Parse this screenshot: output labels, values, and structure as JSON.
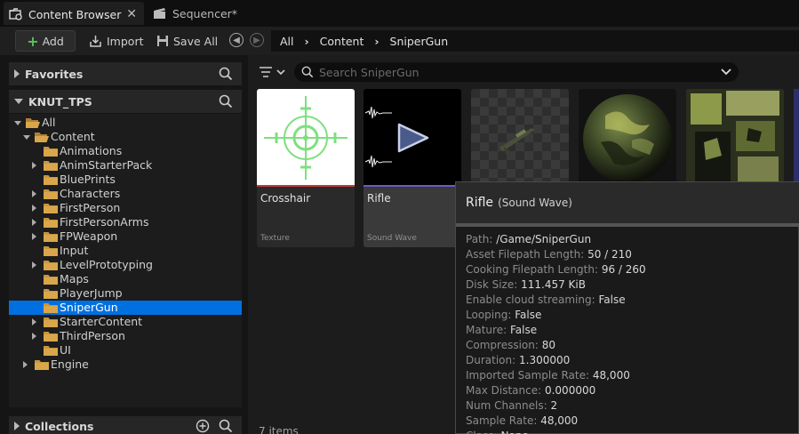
{
  "tabs": [
    {
      "label": "Content Browser",
      "active": true
    },
    {
      "label": "Sequencer*",
      "active": false
    }
  ],
  "toolbar": {
    "add": "Add",
    "import": "Import",
    "save_all": "Save All"
  },
  "breadcrumbs": [
    "All",
    "Content",
    "SniperGun"
  ],
  "favorites": {
    "label": "Favorites"
  },
  "project": {
    "label": "KNUT_TPS"
  },
  "tree": [
    {
      "label": "All",
      "depth": 0,
      "expanded": true,
      "has_children": true
    },
    {
      "label": "Content",
      "depth": 1,
      "expanded": true,
      "has_children": true
    },
    {
      "label": "Animations",
      "depth": 2,
      "has_children": false
    },
    {
      "label": "AnimStarterPack",
      "depth": 2,
      "has_children": true
    },
    {
      "label": "BluePrints",
      "depth": 2,
      "has_children": false
    },
    {
      "label": "Characters",
      "depth": 2,
      "has_children": true
    },
    {
      "label": "FirstPerson",
      "depth": 2,
      "has_children": true
    },
    {
      "label": "FirstPersonArms",
      "depth": 2,
      "has_children": true
    },
    {
      "label": "FPWeapon",
      "depth": 2,
      "has_children": true
    },
    {
      "label": "Input",
      "depth": 2,
      "has_children": false
    },
    {
      "label": "LevelPrototyping",
      "depth": 2,
      "has_children": true
    },
    {
      "label": "Maps",
      "depth": 2,
      "has_children": false
    },
    {
      "label": "PlayerJump",
      "depth": 2,
      "has_children": false
    },
    {
      "label": "SniperGun",
      "depth": 2,
      "has_children": false,
      "selected": true
    },
    {
      "label": "StarterContent",
      "depth": 2,
      "has_children": true
    },
    {
      "label": "ThirdPerson",
      "depth": 2,
      "has_children": true
    },
    {
      "label": "UI",
      "depth": 2,
      "has_children": false
    },
    {
      "label": "Engine",
      "depth": 1,
      "has_children": true
    }
  ],
  "collections": {
    "label": "Collections"
  },
  "search": {
    "placeholder": "Search SniperGun"
  },
  "assets": [
    {
      "name": "Crosshair",
      "type": "Texture",
      "color": "#c23b3b"
    },
    {
      "name": "Rifle",
      "type": "Sound Wave",
      "color": "#6a5acd"
    }
  ],
  "tooltip": {
    "name": "Rifle",
    "type": "(Sound Wave)",
    "props": [
      {
        "k": "Path:",
        "v": "/Game/SniperGun"
      },
      {
        "k": "Asset Filepath Length:",
        "v": "50 / 210"
      },
      {
        "k": "Cooking Filepath Length:",
        "v": "96 / 260"
      },
      {
        "k": "Disk Size:",
        "v": "111.457 KiB"
      },
      {
        "k": "Enable cloud streaming:",
        "v": "False"
      },
      {
        "k": "Looping:",
        "v": "False"
      },
      {
        "k": "Mature:",
        "v": "False"
      },
      {
        "k": "Compression:",
        "v": "80"
      },
      {
        "k": "Duration:",
        "v": "1.300000"
      },
      {
        "k": "Imported Sample Rate:",
        "v": "48,000"
      },
      {
        "k": "Max Distance:",
        "v": "0.000000"
      },
      {
        "k": "Num Channels:",
        "v": "2"
      },
      {
        "k": "Sample Rate:",
        "v": "48,000"
      },
      {
        "k": "Class:",
        "v": "None"
      }
    ]
  },
  "status": {
    "items": "7 items"
  }
}
